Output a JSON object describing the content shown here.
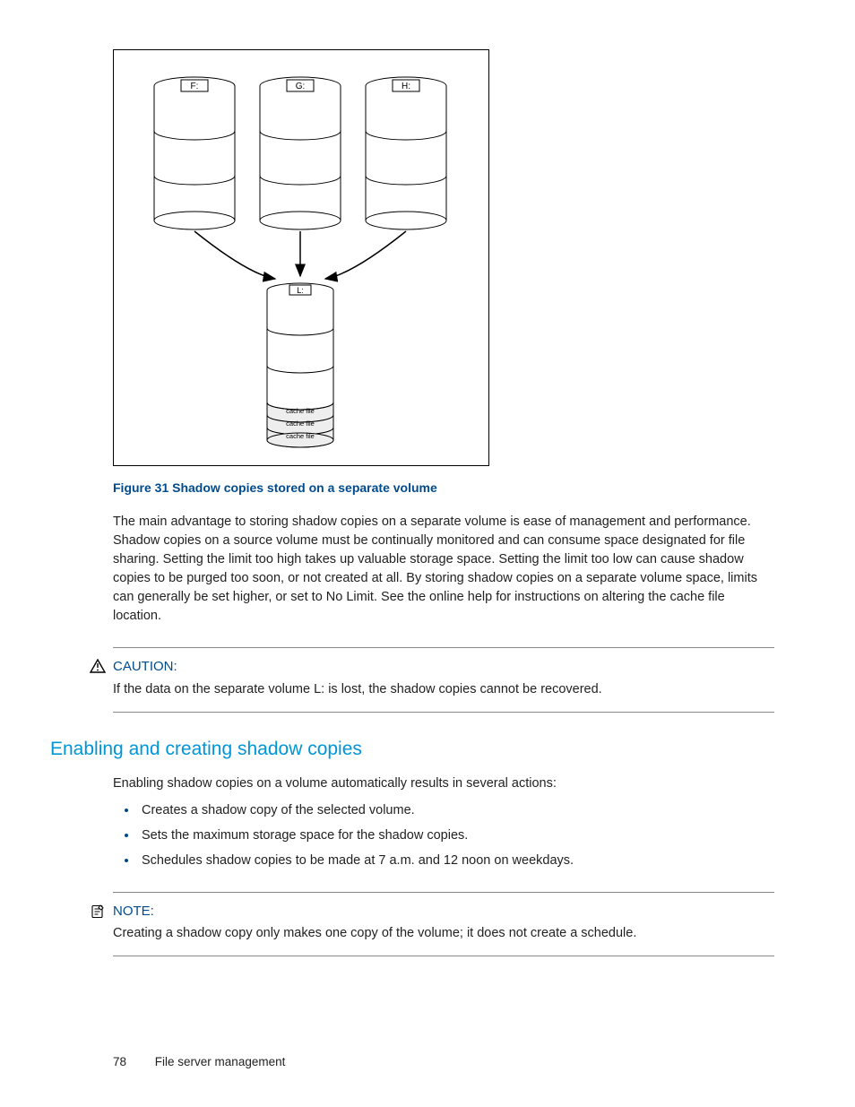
{
  "figure": {
    "drives": {
      "top": [
        "F:",
        "G:",
        "H:"
      ],
      "bottom": "L:"
    },
    "cache_labels": [
      "cache file",
      "cache file",
      "cache file"
    ],
    "caption": "Figure 31 Shadow copies stored on a separate volume"
  },
  "paragraph": "The main advantage to storing shadow copies on a separate volume is ease of management and performance. Shadow copies on a source volume must be continually monitored and can consume space designated for file sharing. Setting the limit too high takes up valuable storage space. Setting the limit too low can cause shadow copies to be purged too soon, or not created at all. By storing shadow copies on a separate volume space, limits can generally be set higher, or set to No Limit. See the online help for instructions on altering the cache file location.",
  "caution": {
    "title": "CAUTION:",
    "body": "If the data on the separate volume L: is lost, the shadow copies cannot be recovered."
  },
  "section": {
    "heading": "Enabling and creating shadow copies",
    "intro": "Enabling shadow copies on a volume automatically results in several actions:",
    "actions": [
      "Creates a shadow copy of the selected volume.",
      "Sets the maximum storage space for the shadow copies.",
      "Schedules shadow copies to be made at 7 a.m. and 12 noon on weekdays."
    ]
  },
  "note": {
    "title": "NOTE:",
    "body": "Creating a shadow copy only makes one copy of the volume; it does not create a schedule."
  },
  "footer": {
    "page_number": "78",
    "section_title": "File server management"
  }
}
